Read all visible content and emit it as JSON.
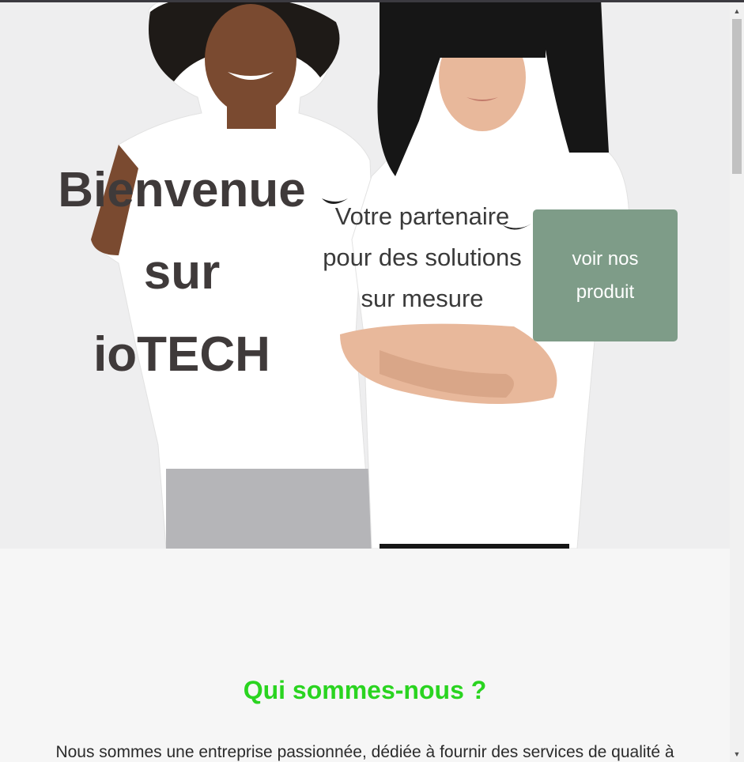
{
  "hero": {
    "title_lines": [
      "Bienvenue",
      "sur",
      "ioTECH"
    ],
    "subtitle": "Votre partenaire pour des solutions sur mesure",
    "cta_label": "voir nos produit"
  },
  "about": {
    "title": "Qui sommes-nous ?",
    "text": "Nous sommes une entreprise passionnée, dédiée à fournir des services de qualité à"
  },
  "scrollbar": {
    "up_icon": "triangle-up-icon",
    "down_icon": "triangle-down-icon"
  },
  "colors": {
    "accent_green": "#2ad420",
    "button_bg": "#7e9c88",
    "hero_bg": "#eeeeef"
  }
}
